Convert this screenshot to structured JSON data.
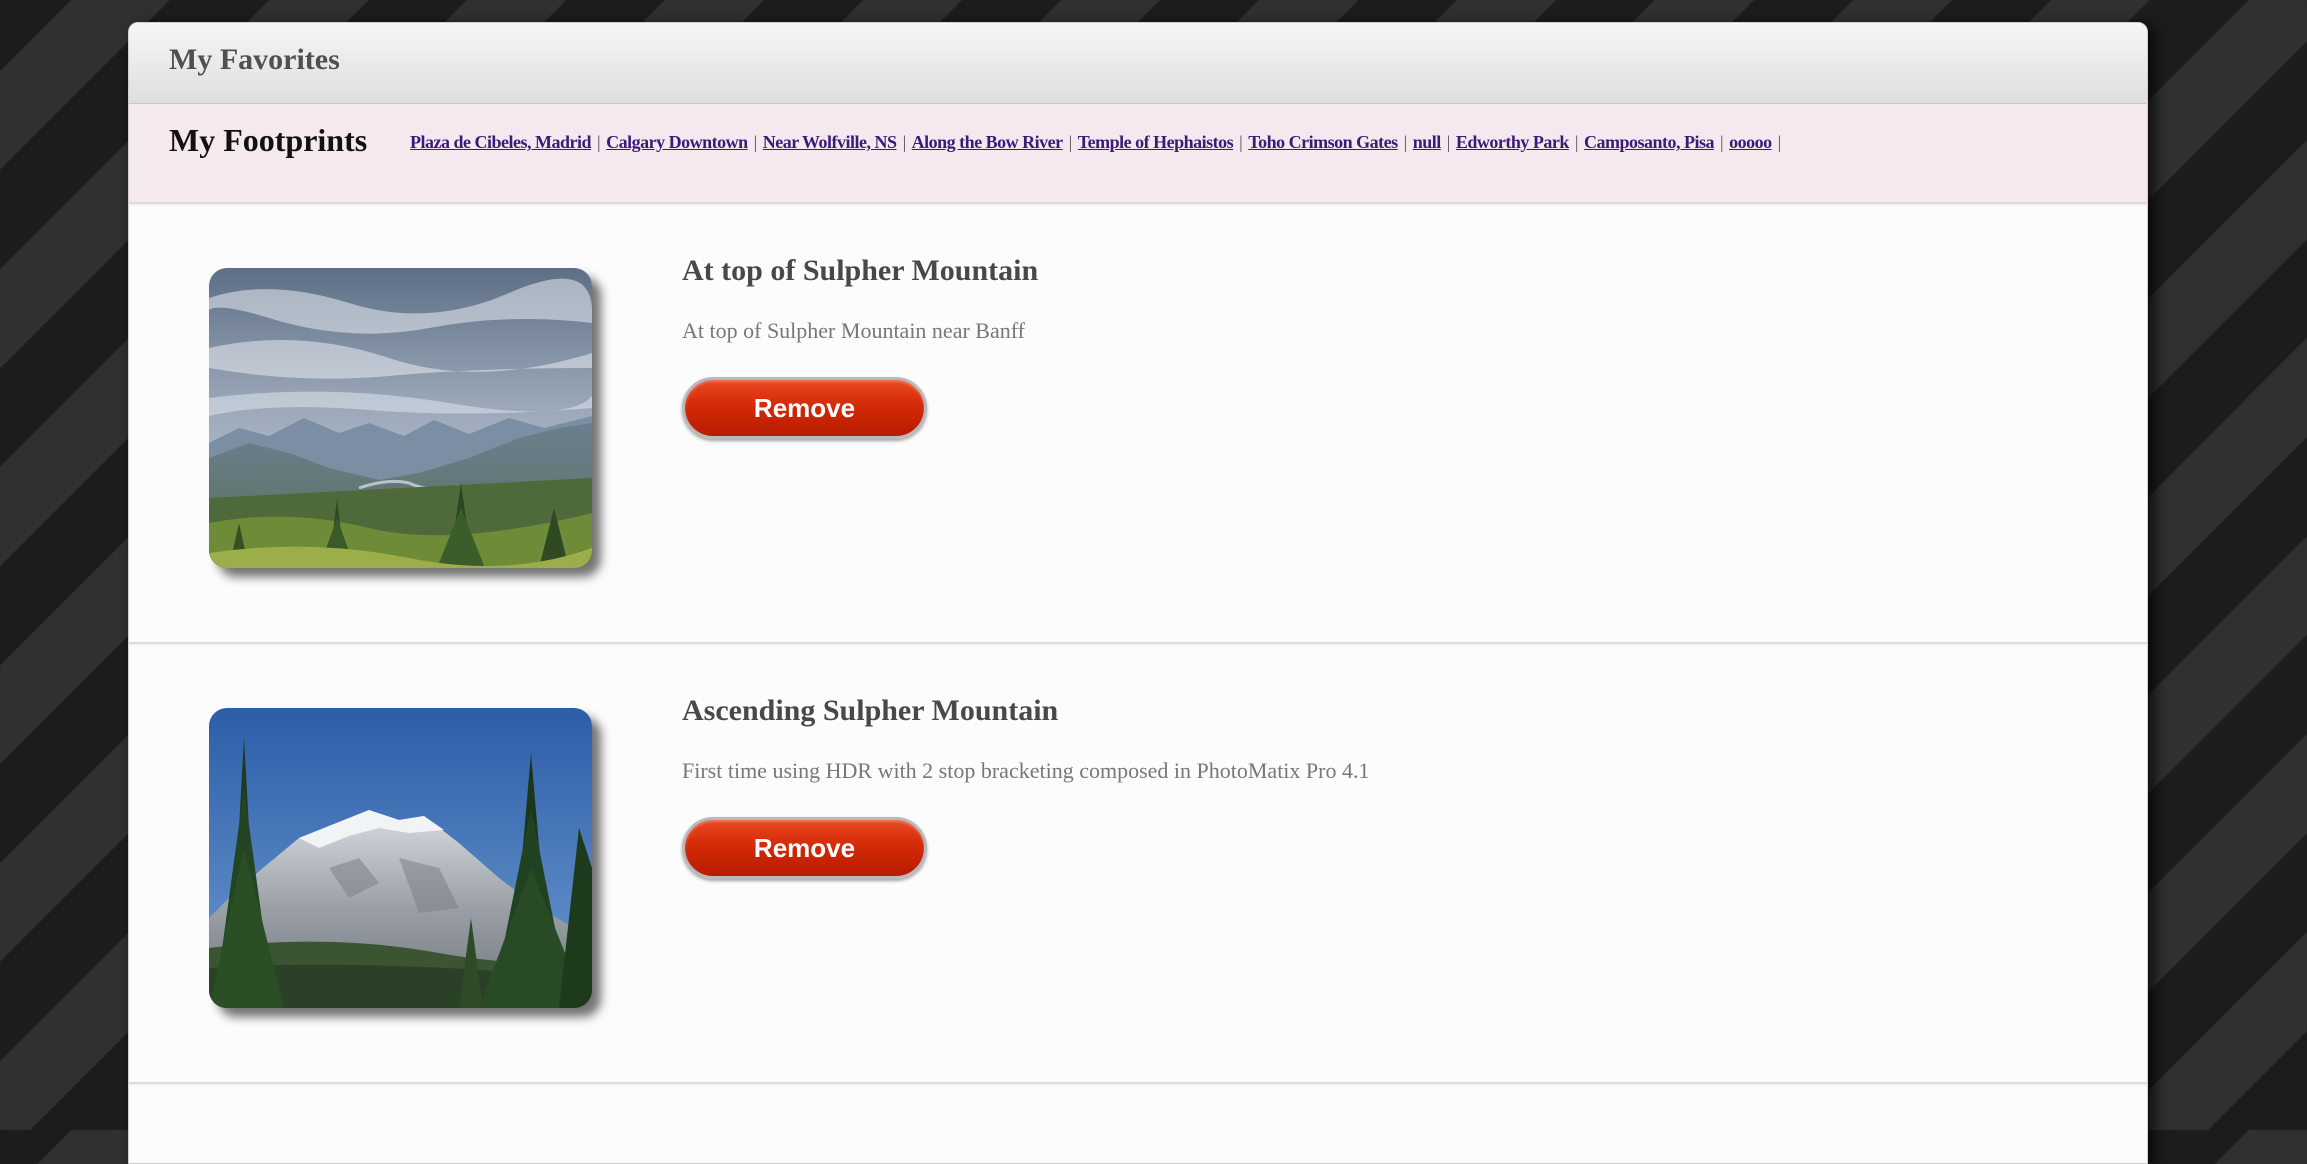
{
  "header": {
    "title": "My Favorites"
  },
  "footprints": {
    "title": "My Footprints",
    "links": [
      "Plaza de Cibeles, Madrid",
      "Calgary Downtown",
      "Near Wolfville, NS",
      "Along the Bow River",
      "Temple of Hephaistos",
      "Toho Crimson Gates",
      "null",
      "Edworthy Park",
      "Camposanto, Pisa",
      "ooooo"
    ],
    "separator": "|"
  },
  "favorites": [
    {
      "title": "At top of Sulpher Mountain",
      "description": "At top of Sulpher Mountain near Banff",
      "button_label": "Remove",
      "image_icon": "mountain-valley-photo"
    },
    {
      "title": "Ascending Sulpher Mountain",
      "description": "First time using HDR with 2 stop bracketing composed in PhotoMatix Pro 4.1",
      "button_label": "Remove",
      "image_icon": "snowy-peak-photo"
    }
  ],
  "colors": {
    "link": "#3e1a78",
    "button": "#d42a08",
    "footprints_bg": "#f5e8ee"
  }
}
